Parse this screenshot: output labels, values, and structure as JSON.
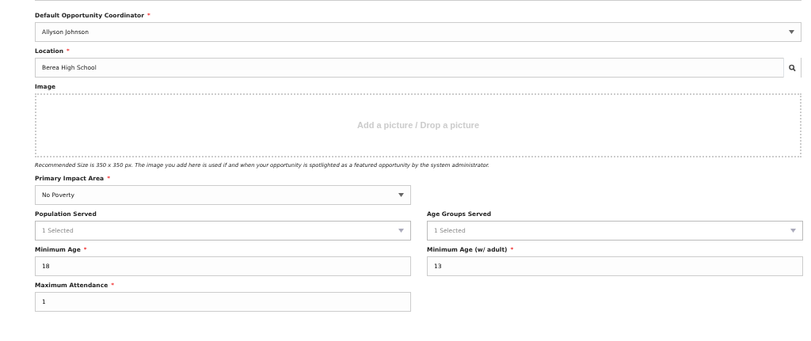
{
  "rows": [
    {
      "fields": [
        {
          "kind": "select",
          "label": "Default Opportunity Coordinator",
          "required_mark": "*",
          "value": "Allyson Johnson"
        }
      ]
    },
    {
      "fields": [
        {
          "kind": "lookup",
          "label": "Location",
          "required_mark": "*",
          "value": "Berea High School"
        }
      ]
    },
    {
      "fields": [
        {
          "kind": "image",
          "label": "Image",
          "prompt": "Add a picture / Drop a picture",
          "help": "Recommended Size is 350 x 350 px. The image you add here is used if and when your opportunity is spotlighted as a featured opportunity by the system administrator."
        }
      ]
    },
    {
      "fields": [
        {
          "kind": "select",
          "label": "Primary Impact Area",
          "required_mark": "*",
          "value": "No Poverty"
        }
      ]
    },
    {
      "fields": [
        {
          "kind": "multiselect",
          "label": "Population Served",
          "value": "1 Selected"
        },
        {
          "kind": "multiselect",
          "label": "Age Groups Served",
          "value": "1 Selected"
        }
      ]
    },
    {
      "fields": [
        {
          "kind": "input",
          "label": "Minimum Age",
          "required_mark": "*",
          "value": "18"
        },
        {
          "kind": "input",
          "label": "Minimum Age (w/ adult)",
          "required_mark": "*",
          "value": "13"
        }
      ]
    },
    {
      "fields": [
        {
          "kind": "input",
          "label": "Maximum Attendance",
          "required_mark": "*",
          "value": "1"
        }
      ]
    }
  ]
}
